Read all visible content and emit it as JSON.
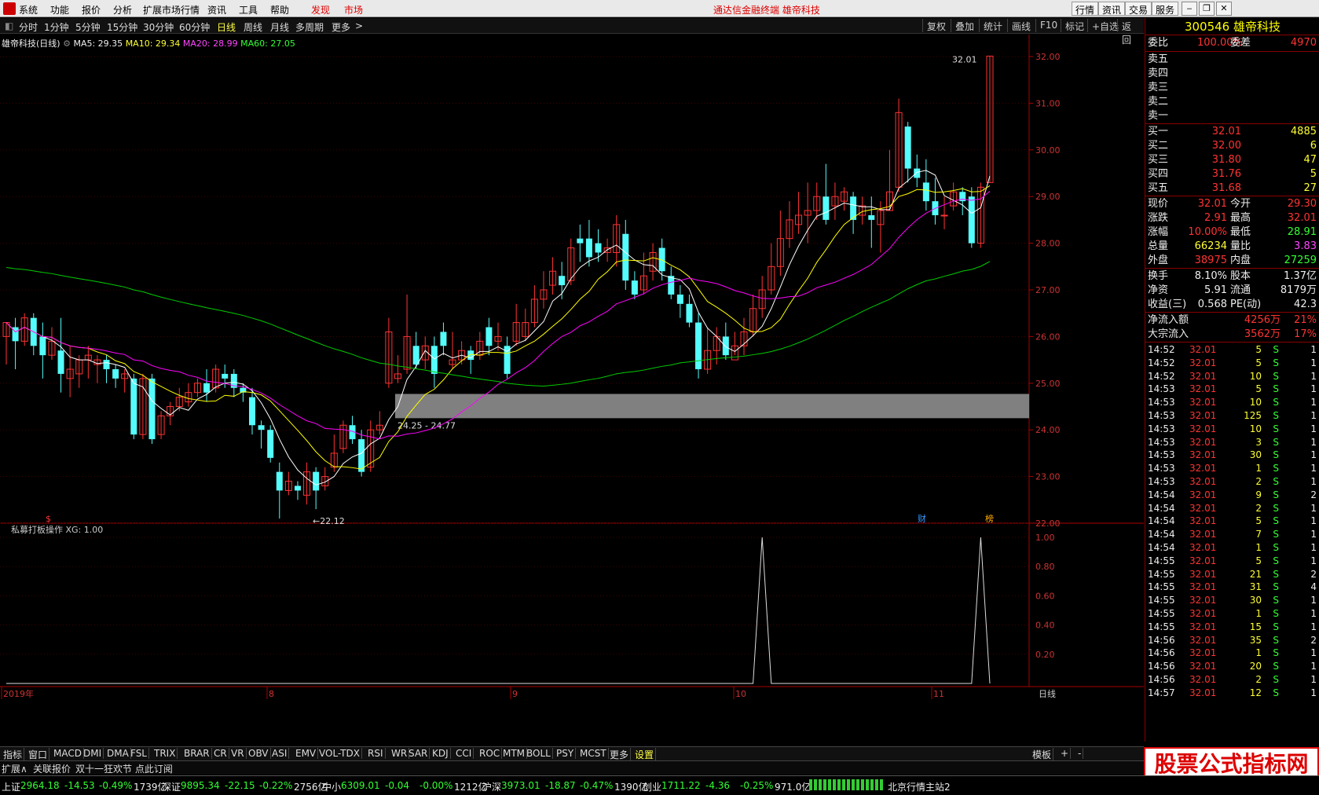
{
  "menu": {
    "items": [
      "系统",
      "功能",
      "报价",
      "分析",
      "扩展市场行情",
      "资讯",
      "工具",
      "帮助"
    ],
    "discover": "发现",
    "market": "市场",
    "banner": "通达信金融终端  雄帝科技",
    "right_buttons": [
      "行情",
      "资讯",
      "交易",
      "服务"
    ]
  },
  "period": {
    "items": [
      "分时",
      "1分钟",
      "5分钟",
      "15分钟",
      "30分钟",
      "60分钟",
      "日线",
      "周线",
      "月线",
      "多周期",
      "更多"
    ],
    "active": "日线",
    "tools": [
      "复权",
      "叠加",
      "统计",
      "画线",
      "F10",
      "标记",
      "+自选",
      "返回"
    ]
  },
  "chart": {
    "title": "雄帝科技(日线)",
    "ma5": "MA5: 29.35",
    "ma10": "MA10: 29.34",
    "ma20": "MA20: 28.99",
    "ma60": "MA60: 27.05",
    "high_label": "32.01",
    "low_label": "22.12",
    "gap_label": "24.25 - 24.77",
    "mark_s": "$",
    "mark_cai": "财",
    "mark_bang": "榜",
    "indicator_title": "私募打板操作  XG: 1.00",
    "date_labels": [
      "2019年",
      "8",
      "9",
      "10",
      "11"
    ],
    "period_label": "日线",
    "colors": {
      "up": "#ff3333",
      "down": "#54fcfc",
      "ma5": "#ffffff",
      "ma10": "#ffff00",
      "ma20": "#ff00ff",
      "ma60": "#00cc00",
      "gap": "#808080"
    }
  },
  "chart_data": {
    "type": "candlestick",
    "title": "雄帝科技(日线)",
    "ylim": [
      22.0,
      32.0
    ],
    "y_ticks": [
      "32.00",
      "31.00",
      "30.00",
      "29.00",
      "28.00",
      "27.00",
      "26.00",
      "25.00",
      "24.00",
      "23.00",
      "22.00"
    ],
    "indicator_ticks": [
      "1.00",
      "0.80",
      "0.60",
      "0.40",
      "0.20"
    ],
    "indicator_ylim": [
      0,
      1.0
    ],
    "x_ticks": [
      "2019年",
      "8",
      "9",
      "10",
      "11"
    ],
    "candles": [
      [
        26.0,
        26.3,
        26.3,
        25.4
      ],
      [
        26.2,
        25.9,
        26.4,
        25.3
      ],
      [
        25.9,
        26.4,
        26.5,
        25.8
      ],
      [
        26.4,
        25.8,
        26.5,
        25.6
      ],
      [
        26.0,
        25.6,
        26.3,
        25.1
      ],
      [
        25.6,
        25.9,
        26.2,
        25.5
      ],
      [
        25.7,
        25.2,
        26.4,
        24.8
      ],
      [
        25.1,
        25.3,
        25.8,
        24.7
      ],
      [
        25.2,
        25.5,
        25.6,
        24.9
      ],
      [
        25.5,
        25.6,
        25.8,
        25.1
      ],
      [
        25.4,
        25.5,
        25.6,
        25.0
      ],
      [
        25.5,
        25.3,
        25.6,
        25.0
      ],
      [
        25.3,
        25.1,
        25.4,
        24.9
      ],
      [
        25.1,
        25.2,
        25.3,
        24.8
      ],
      [
        25.1,
        23.9,
        25.2,
        23.8
      ],
      [
        23.9,
        25.1,
        25.2,
        23.8
      ],
      [
        25.1,
        23.8,
        25.2,
        23.7
      ],
      [
        23.9,
        24.3,
        24.4,
        23.8
      ],
      [
        24.3,
        24.5,
        24.6,
        24.1
      ],
      [
        24.5,
        24.7,
        24.9,
        24.4
      ],
      [
        24.6,
        24.8,
        25.0,
        24.5
      ],
      [
        24.8,
        25.0,
        25.1,
        24.7
      ],
      [
        25.0,
        24.8,
        25.3,
        24.6
      ],
      [
        24.9,
        25.3,
        25.4,
        24.8
      ],
      [
        25.2,
        25.1,
        25.4,
        24.9
      ],
      [
        25.2,
        24.9,
        25.3,
        24.7
      ],
      [
        24.9,
        24.8,
        25.0,
        24.6
      ],
      [
        24.7,
        24.1,
        24.9,
        23.9
      ],
      [
        24.1,
        24.0,
        24.2,
        23.6
      ],
      [
        24.0,
        23.4,
        24.1,
        23.3
      ],
      [
        23.1,
        22.7,
        23.3,
        22.1
      ],
      [
        22.7,
        22.9,
        23.1,
        22.6
      ],
      [
        22.8,
        22.7,
        22.9,
        22.5
      ],
      [
        22.6,
        23.1,
        23.3,
        22.4
      ],
      [
        23.1,
        22.7,
        23.2,
        22.3
      ],
      [
        22.8,
        23.0,
        23.2,
        22.7
      ],
      [
        23.2,
        23.5,
        23.9,
        23.1
      ],
      [
        23.6,
        24.1,
        24.2,
        23.5
      ],
      [
        24.1,
        23.8,
        24.3,
        23.7
      ],
      [
        23.8,
        23.1,
        24.0,
        23.0
      ],
      [
        23.2,
        24.0,
        24.2,
        23.1
      ],
      [
        24.0,
        24.1,
        24.4,
        23.9
      ],
      [
        25.0,
        26.1,
        26.4,
        24.9
      ],
      [
        25.1,
        25.2,
        25.6,
        25.0
      ],
      [
        25.3,
        26.0,
        26.9,
        25.2
      ],
      [
        25.8,
        25.4,
        26.1,
        25.3
      ],
      [
        25.5,
        25.8,
        26.0,
        25.3
      ],
      [
        25.8,
        25.2,
        26.0,
        24.9
      ],
      [
        26.1,
        25.8,
        26.3,
        25.6
      ],
      [
        25.4,
        25.5,
        26.1,
        25.3
      ],
      [
        25.5,
        25.7,
        25.9,
        25.4
      ],
      [
        25.7,
        25.5,
        25.8,
        25.2
      ],
      [
        25.6,
        25.9,
        26.1,
        25.5
      ],
      [
        26.2,
        25.8,
        26.4,
        25.6
      ],
      [
        25.9,
        26.0,
        26.3,
        25.7
      ],
      [
        25.8,
        25.2,
        26.0,
        25.1
      ],
      [
        25.9,
        26.3,
        26.7,
        25.8
      ],
      [
        26.0,
        26.3,
        26.6,
        25.9
      ],
      [
        26.3,
        26.8,
        27.1,
        26.2
      ],
      [
        26.8,
        27.0,
        27.4,
        26.6
      ],
      [
        27.1,
        27.4,
        27.7,
        26.9
      ],
      [
        27.3,
        27.1,
        27.6,
        26.8
      ],
      [
        27.2,
        27.9,
        28.1,
        27.1
      ],
      [
        28.1,
        28.0,
        28.4,
        27.6
      ],
      [
        28.1,
        27.7,
        28.5,
        27.5
      ],
      [
        28.0,
        27.8,
        28.3,
        27.6
      ],
      [
        27.8,
        27.9,
        28.1,
        27.6
      ],
      [
        27.8,
        28.4,
        28.6,
        27.5
      ],
      [
        28.2,
        27.2,
        28.5,
        27.0
      ],
      [
        27.2,
        26.9,
        27.4,
        26.8
      ],
      [
        27.0,
        27.3,
        27.8,
        26.9
      ],
      [
        27.4,
        27.8,
        28.0,
        27.2
      ],
      [
        27.9,
        27.4,
        28.1,
        27.2
      ],
      [
        27.3,
        26.9,
        27.5,
        26.8
      ],
      [
        26.9,
        26.7,
        27.1,
        26.4
      ],
      [
        26.7,
        26.3,
        26.9,
        26.2
      ],
      [
        26.3,
        25.3,
        26.5,
        25.1
      ],
      [
        25.3,
        25.7,
        26.2,
        25.2
      ],
      [
        25.7,
        26.0,
        26.2,
        25.4
      ],
      [
        26.0,
        25.6,
        26.3,
        25.5
      ],
      [
        25.5,
        25.8,
        26.1,
        25.6
      ],
      [
        25.8,
        26.1,
        26.4,
        25.6
      ],
      [
        26.1,
        26.6,
        26.9,
        26.0
      ],
      [
        26.6,
        27.0,
        27.3,
        26.4
      ],
      [
        27.0,
        27.5,
        28.0,
        26.9
      ],
      [
        27.5,
        28.1,
        28.7,
        27.3
      ],
      [
        28.1,
        28.5,
        28.9,
        27.9
      ],
      [
        28.4,
        28.6,
        29.1,
        28.2
      ],
      [
        28.6,
        28.7,
        29.3,
        28.0
      ],
      [
        28.7,
        29.0,
        29.3,
        28.5
      ],
      [
        29.0,
        28.5,
        29.7,
        28.4
      ],
      [
        28.8,
        29.0,
        29.3,
        28.5
      ],
      [
        28.9,
        29.1,
        29.2,
        28.7
      ],
      [
        29.0,
        28.5,
        29.1,
        28.2
      ],
      [
        28.6,
        28.8,
        29.0,
        28.4
      ],
      [
        28.6,
        28.5,
        29.0,
        27.9
      ],
      [
        28.4,
        28.7,
        28.9,
        27.8
      ],
      [
        28.7,
        29.1,
        30.0,
        28.7
      ],
      [
        29.2,
        30.8,
        31.1,
        29.1
      ],
      [
        30.5,
        29.6,
        30.6,
        29.3
      ],
      [
        29.6,
        29.4,
        29.9,
        29.2
      ],
      [
        29.3,
        28.9,
        29.8,
        28.7
      ],
      [
        28.9,
        28.6,
        29.4,
        28.4
      ],
      [
        28.6,
        28.6,
        29.0,
        28.3
      ],
      [
        28.8,
        29.1,
        29.3,
        28.7
      ],
      [
        29.1,
        28.9,
        29.2,
        28.6
      ],
      [
        29.0,
        28.0,
        29.2,
        27.9
      ],
      [
        28.0,
        29.2,
        29.3,
        27.9
      ],
      [
        29.3,
        32.01,
        32.01,
        29.3
      ]
    ],
    "gap_zone": [
      24.25,
      24.77
    ],
    "xg_signal_indices": [
      83,
      107
    ]
  },
  "quote": {
    "code": "300546",
    "name": "雄帝科技",
    "webi_label": "委比",
    "webi_val": "100.00%",
    "wecha_label": "委差",
    "wecha_val": "4970",
    "sell": [
      {
        "l": "卖五",
        "p": "",
        "v": ""
      },
      {
        "l": "卖四",
        "p": "",
        "v": ""
      },
      {
        "l": "卖三",
        "p": "",
        "v": ""
      },
      {
        "l": "卖二",
        "p": "",
        "v": ""
      },
      {
        "l": "卖一",
        "p": "",
        "v": ""
      }
    ],
    "buy": [
      {
        "l": "买一",
        "p": "32.01",
        "v": "4885"
      },
      {
        "l": "买二",
        "p": "32.00",
        "v": "6"
      },
      {
        "l": "买三",
        "p": "31.80",
        "v": "47"
      },
      {
        "l": "买四",
        "p": "31.76",
        "v": "5"
      },
      {
        "l": "买五",
        "p": "31.68",
        "v": "27"
      }
    ],
    "stats": [
      {
        "l1": "现价",
        "v1": "32.01",
        "c1": "red",
        "l2": "今开",
        "v2": "29.30",
        "c2": "red"
      },
      {
        "l1": "涨跌",
        "v1": "2.91",
        "c1": "red",
        "l2": "最高",
        "v2": "32.01",
        "c2": "red"
      },
      {
        "l1": "涨幅",
        "v1": "10.00%",
        "c1": "red",
        "l2": "最低",
        "v2": "28.91",
        "c2": "green"
      },
      {
        "l1": "总量",
        "v1": "66234",
        "c1": "yellow",
        "l2": "量比",
        "v2": "3.83",
        "c2": "mag"
      },
      {
        "l1": "外盘",
        "v1": "38975",
        "c1": "red",
        "l2": "内盘",
        "v2": "27259",
        "c2": "green"
      }
    ],
    "stats2": [
      {
        "l1": "换手",
        "v1": "8.10%",
        "l2": "股本",
        "v2": "1.37亿"
      },
      {
        "l1": "净资",
        "v1": "5.91",
        "l2": "流通",
        "v2": "8179万"
      },
      {
        "l1": "收益(三)",
        "v1": "0.568",
        "l2": "PE(动)",
        "v2": "42.3"
      }
    ],
    "flow": [
      {
        "l": "净流入额",
        "v": "4256万",
        "p": "21%"
      },
      {
        "l": "大宗流入",
        "v": "3562万",
        "p": "17%"
      }
    ],
    "ticks": [
      [
        "14:52",
        "32.01",
        "5",
        "S",
        "1"
      ],
      [
        "14:52",
        "32.01",
        "5",
        "S",
        "1"
      ],
      [
        "14:52",
        "32.01",
        "10",
        "S",
        "1"
      ],
      [
        "14:53",
        "32.01",
        "5",
        "S",
        "1"
      ],
      [
        "14:53",
        "32.01",
        "10",
        "S",
        "1"
      ],
      [
        "14:53",
        "32.01",
        "125",
        "S",
        "1"
      ],
      [
        "14:53",
        "32.01",
        "10",
        "S",
        "1"
      ],
      [
        "14:53",
        "32.01",
        "3",
        "S",
        "1"
      ],
      [
        "14:53",
        "32.01",
        "30",
        "S",
        "1"
      ],
      [
        "14:53",
        "32.01",
        "1",
        "S",
        "1"
      ],
      [
        "14:53",
        "32.01",
        "2",
        "S",
        "1"
      ],
      [
        "14:54",
        "32.01",
        "9",
        "S",
        "2"
      ],
      [
        "14:54",
        "32.01",
        "2",
        "S",
        "1"
      ],
      [
        "14:54",
        "32.01",
        "5",
        "S",
        "1"
      ],
      [
        "14:54",
        "32.01",
        "7",
        "S",
        "1"
      ],
      [
        "14:54",
        "32.01",
        "1",
        "S",
        "1"
      ],
      [
        "14:55",
        "32.01",
        "5",
        "S",
        "1"
      ],
      [
        "14:55",
        "32.01",
        "21",
        "S",
        "2"
      ],
      [
        "14:55",
        "32.01",
        "31",
        "S",
        "4"
      ],
      [
        "14:55",
        "32.01",
        "30",
        "S",
        "1"
      ],
      [
        "14:55",
        "32.01",
        "1",
        "S",
        "1"
      ],
      [
        "14:55",
        "32.01",
        "15",
        "S",
        "1"
      ],
      [
        "14:56",
        "32.01",
        "35",
        "S",
        "2"
      ],
      [
        "14:56",
        "32.01",
        "1",
        "S",
        "1"
      ],
      [
        "14:56",
        "32.01",
        "20",
        "S",
        "1"
      ],
      [
        "14:56",
        "32.01",
        "2",
        "S",
        "1"
      ],
      [
        "14:57",
        "32.01",
        "12",
        "S",
        "1"
      ]
    ]
  },
  "indicators": [
    "指标",
    "窗口",
    "MACD",
    "DMI",
    "DMA",
    "FSL",
    "TRIX",
    "BRAR",
    "CR",
    "VR",
    "OBV",
    "ASI",
    "EMV",
    "VOL-TDX",
    "RSI",
    "WR",
    "SAR",
    "KDJ",
    "CCI",
    "ROC",
    "MTM",
    "BOLL",
    "PSY",
    "MCST",
    "更多",
    "设置"
  ],
  "indicator_right": [
    "模板",
    "+",
    "-"
  ],
  "bottom2": {
    "a": "扩展∧",
    "b": "关联报价",
    "c": "双十一狂欢节 点此订阅"
  },
  "status": {
    "sh": {
      "l": "上证",
      "v": "2964.18",
      "c": "-14.53",
      "p": "-0.49%",
      "a": "1739亿"
    },
    "sz": {
      "l": "深证",
      "v": "9895.34",
      "c": "-22.15",
      "p": "-0.22%",
      "a": "2756亿"
    },
    "zx": {
      "l": "中小",
      "v": "6309.01",
      "c": "-0.04",
      "p": "-0.00%",
      "a": "1212亿"
    },
    "hs": {
      "l": "沪深",
      "v": "3973.01",
      "c": "-18.87",
      "p": "-0.47%",
      "a": "1390亿"
    },
    "cy": {
      "l": "创业",
      "v": "1711.22",
      "c": "-4.36",
      "p": "-0.25%",
      "a": "971.0亿"
    },
    "server": "北京行情主站2"
  },
  "watermark": "股票公式指标网"
}
